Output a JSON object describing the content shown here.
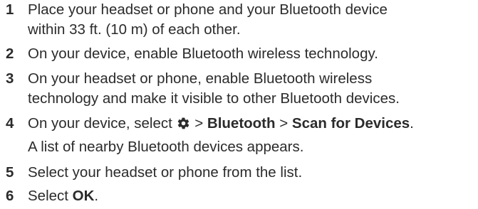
{
  "steps": [
    {
      "number": "1",
      "lines": [
        "Place your headset or phone and your Bluetooth device",
        "within 33 ft. (10 m) of each other."
      ]
    },
    {
      "number": "2",
      "lines": [
        "On your device, enable Bluetooth wireless technology."
      ]
    },
    {
      "number": "3",
      "lines": [
        "On your headset or phone, enable Bluetooth wireless",
        "technology and make it visible to other Bluetooth devices."
      ]
    },
    {
      "number": "4",
      "prefix": "On your device, select ",
      "icon": "gear-icon",
      "sep1": " > ",
      "menu1": "Bluetooth",
      "sep2": " > ",
      "menu2": "Scan for Devices",
      "end": ".",
      "note": "A list of nearby Bluetooth devices appears."
    },
    {
      "number": "5",
      "lines": [
        "Select your headset or phone from the list."
      ]
    },
    {
      "number": "6",
      "prefix": "Select ",
      "button": "OK",
      "end": "."
    }
  ]
}
